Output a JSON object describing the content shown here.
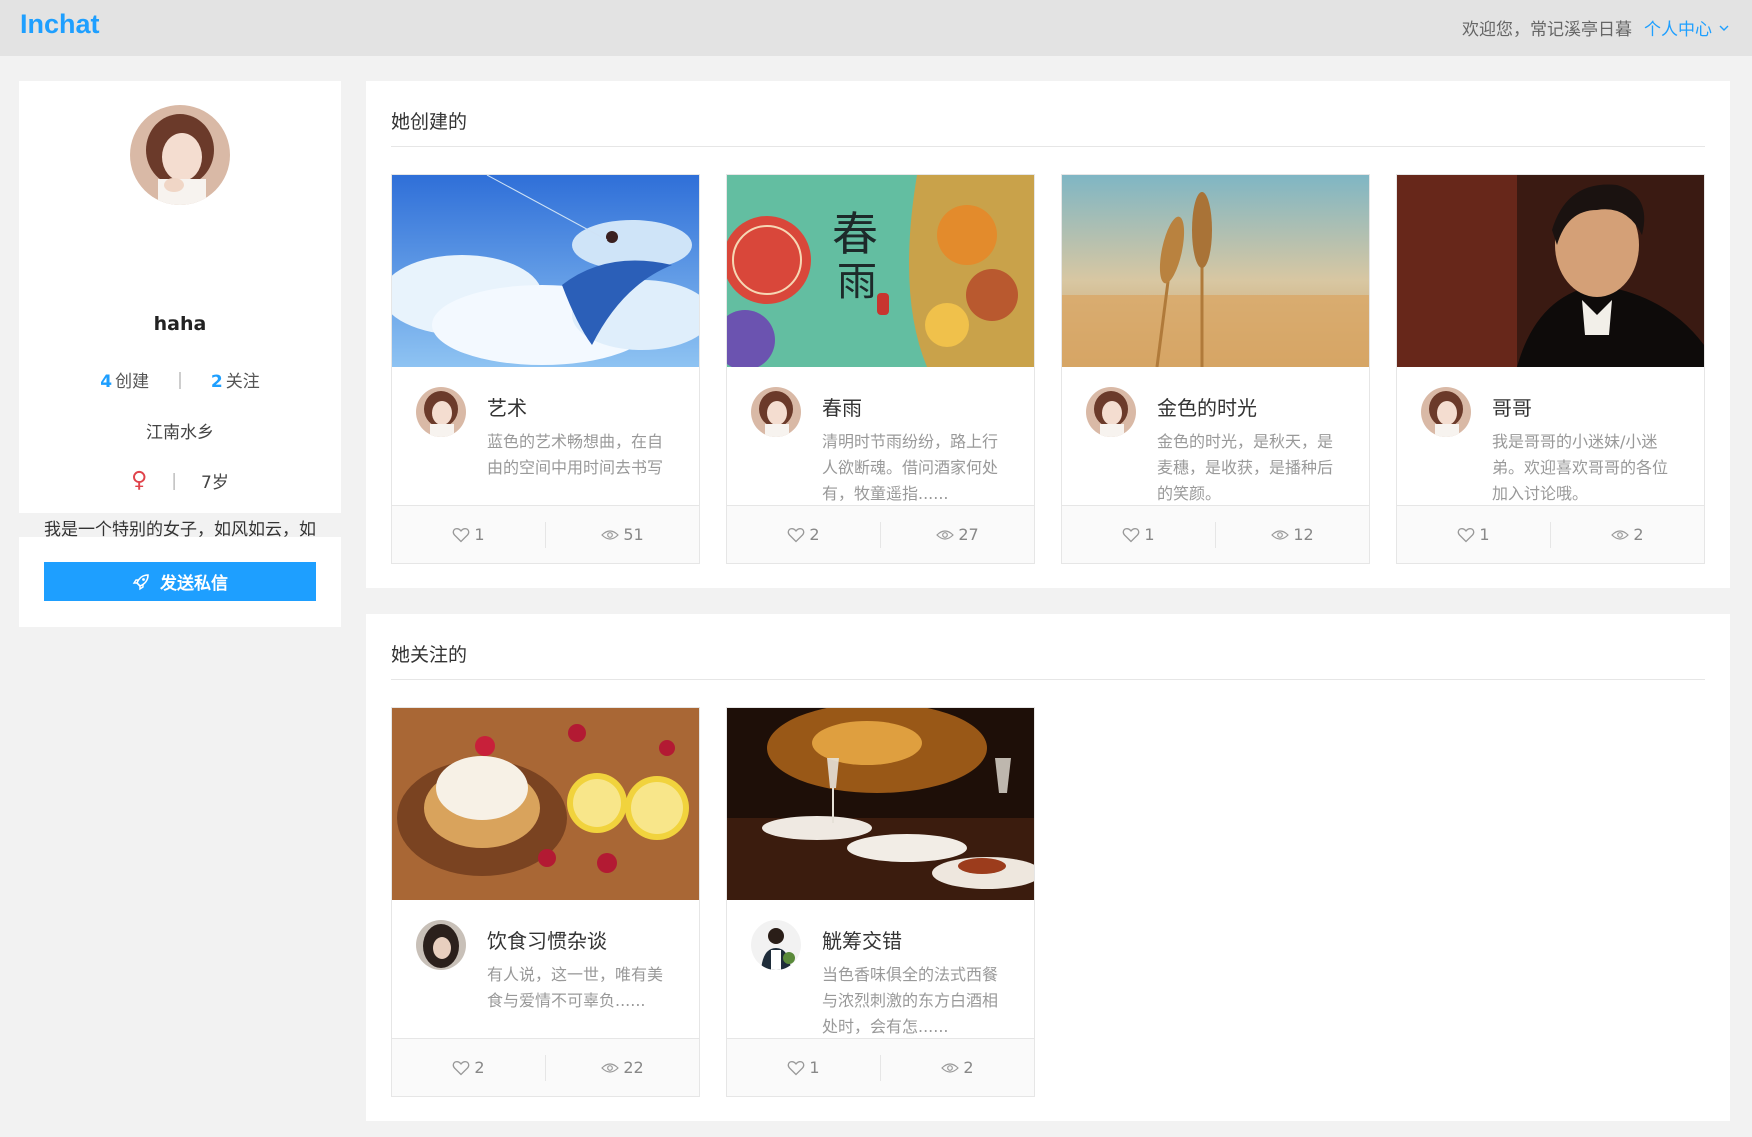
{
  "header": {
    "logo": "Inchat",
    "welcome": "欢迎您，常记溪亭日暮",
    "user_center": "个人中心"
  },
  "profile": {
    "username": "haha",
    "created_count": "4",
    "created_label": "创建",
    "following_count": "2",
    "following_label": "关注",
    "hometown": "江南水乡",
    "gender_symbol": "♀",
    "age": "7岁",
    "bio": "我是一个特别的女子，如风如云，如自由的奔跑"
  },
  "message_button": "发送私信",
  "created_section": {
    "title": "她创建的",
    "cards": [
      {
        "title": "艺术",
        "desc": "蓝色的艺术畅想曲，在自由的空间中用时间去书写",
        "likes": "1",
        "views": "51",
        "image": "anime-sky-whale"
      },
      {
        "title": "春雨",
        "desc": "清明时节雨纷纷，路上行人欲断魂。借问酒家何处有，牧童遥指......",
        "likes": "2",
        "views": "27",
        "image": "spring-rain-art"
      },
      {
        "title": "金色的时光",
        "desc": "金色的时光，是秋天，是麦穗，是收获，是播种后的笑颜。",
        "likes": "1",
        "views": "12",
        "image": "wheat-field"
      },
      {
        "title": "哥哥",
        "desc": "我是哥哥的小迷妹/小迷弟。欢迎喜欢哥哥的各位加入讨论哦。",
        "likes": "1",
        "views": "2",
        "image": "man-portrait"
      }
    ]
  },
  "following_section": {
    "title": "她关注的",
    "cards": [
      {
        "title": "饮食习惯杂谈",
        "desc": "有人说，这一世，唯有美食与爱情不可辜负......",
        "likes": "2",
        "views": "22",
        "image": "lemon-tart"
      },
      {
        "title": "觥筹交错",
        "desc": "当色香味俱全的法式西餐与浓烈刺激的东方白酒相处时，会有怎......",
        "likes": "1",
        "views": "2",
        "image": "restaurant-dinner"
      }
    ]
  },
  "colors": {
    "accent": "#1e9fff",
    "gender": "#e0434b"
  }
}
